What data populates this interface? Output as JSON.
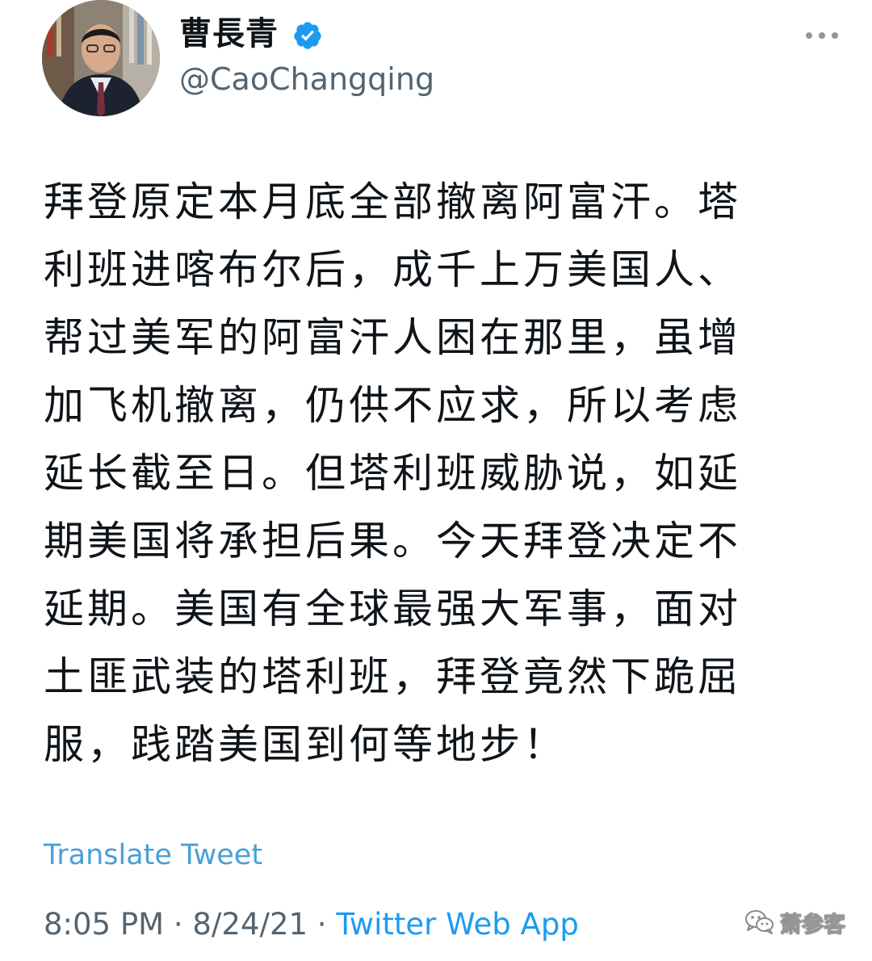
{
  "profile": {
    "display_name": "曹長青",
    "handle": "@CaoChangqing",
    "verified": true
  },
  "tweet": {
    "lines": [
      "拜登原定本月底全部撤离阿富汗。塔",
      "利班进喀布尔后，成千上万美国人、",
      "帮过美军的阿富汗人困在那里，虽增",
      "加飞机撤离，仍供不应求，所以考虑",
      "延长截至日。但塔利班威胁说，如延",
      "期美国将承担后果。今天拜登决定不",
      "延期。美国有全球最强大军事，面对",
      "土匪武装的塔利班，拜登竟然下跪屈",
      "服，践踏美国到何等地步！"
    ],
    "translate_label": "Translate Tweet",
    "time": "8:05 PM",
    "separator": " · ",
    "date": "8/24/21",
    "source": "Twitter Web App"
  },
  "watermark": {
    "text": "萧参客",
    "icon": "wechat-icon"
  },
  "icons": {
    "verified": "verified-badge-icon",
    "more": "more-options-icon"
  },
  "colors": {
    "verified_badge": "#1d9bf0",
    "link": "#1d9bf0",
    "secondary_text": "#536471",
    "primary_text": "#0f1419"
  }
}
